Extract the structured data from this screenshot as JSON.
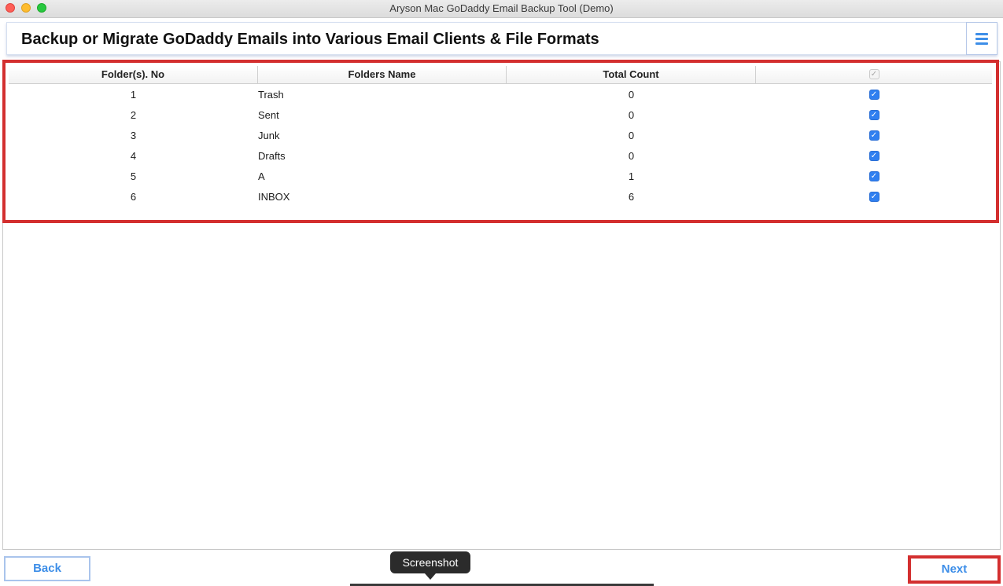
{
  "window": {
    "title": "Aryson Mac GoDaddy Email Backup Tool (Demo)"
  },
  "header": {
    "title": "Backup or Migrate GoDaddy Emails into Various Email Clients & File Formats",
    "menu_icon": "hamburger-menu-icon"
  },
  "table": {
    "columns": [
      "Folder(s). No",
      "Folders Name",
      "Total Count"
    ],
    "select_all_checked": true,
    "rows": [
      {
        "no": "1",
        "name": "Trash",
        "count": "0",
        "checked": true
      },
      {
        "no": "2",
        "name": "Sent",
        "count": "0",
        "checked": true
      },
      {
        "no": "3",
        "name": "Junk",
        "count": "0",
        "checked": true
      },
      {
        "no": "4",
        "name": "Drafts",
        "count": "0",
        "checked": true
      },
      {
        "no": "5",
        "name": "A",
        "count": "1",
        "checked": true
      },
      {
        "no": "6",
        "name": "INBOX",
        "count": "6",
        "checked": true
      }
    ]
  },
  "footer": {
    "back_label": "Back",
    "next_label": "Next",
    "tooltip": "Screenshot"
  },
  "colors": {
    "accent": "#3d8ee8",
    "highlight_border": "#d32f2f",
    "checkbox": "#2f7ff0"
  }
}
